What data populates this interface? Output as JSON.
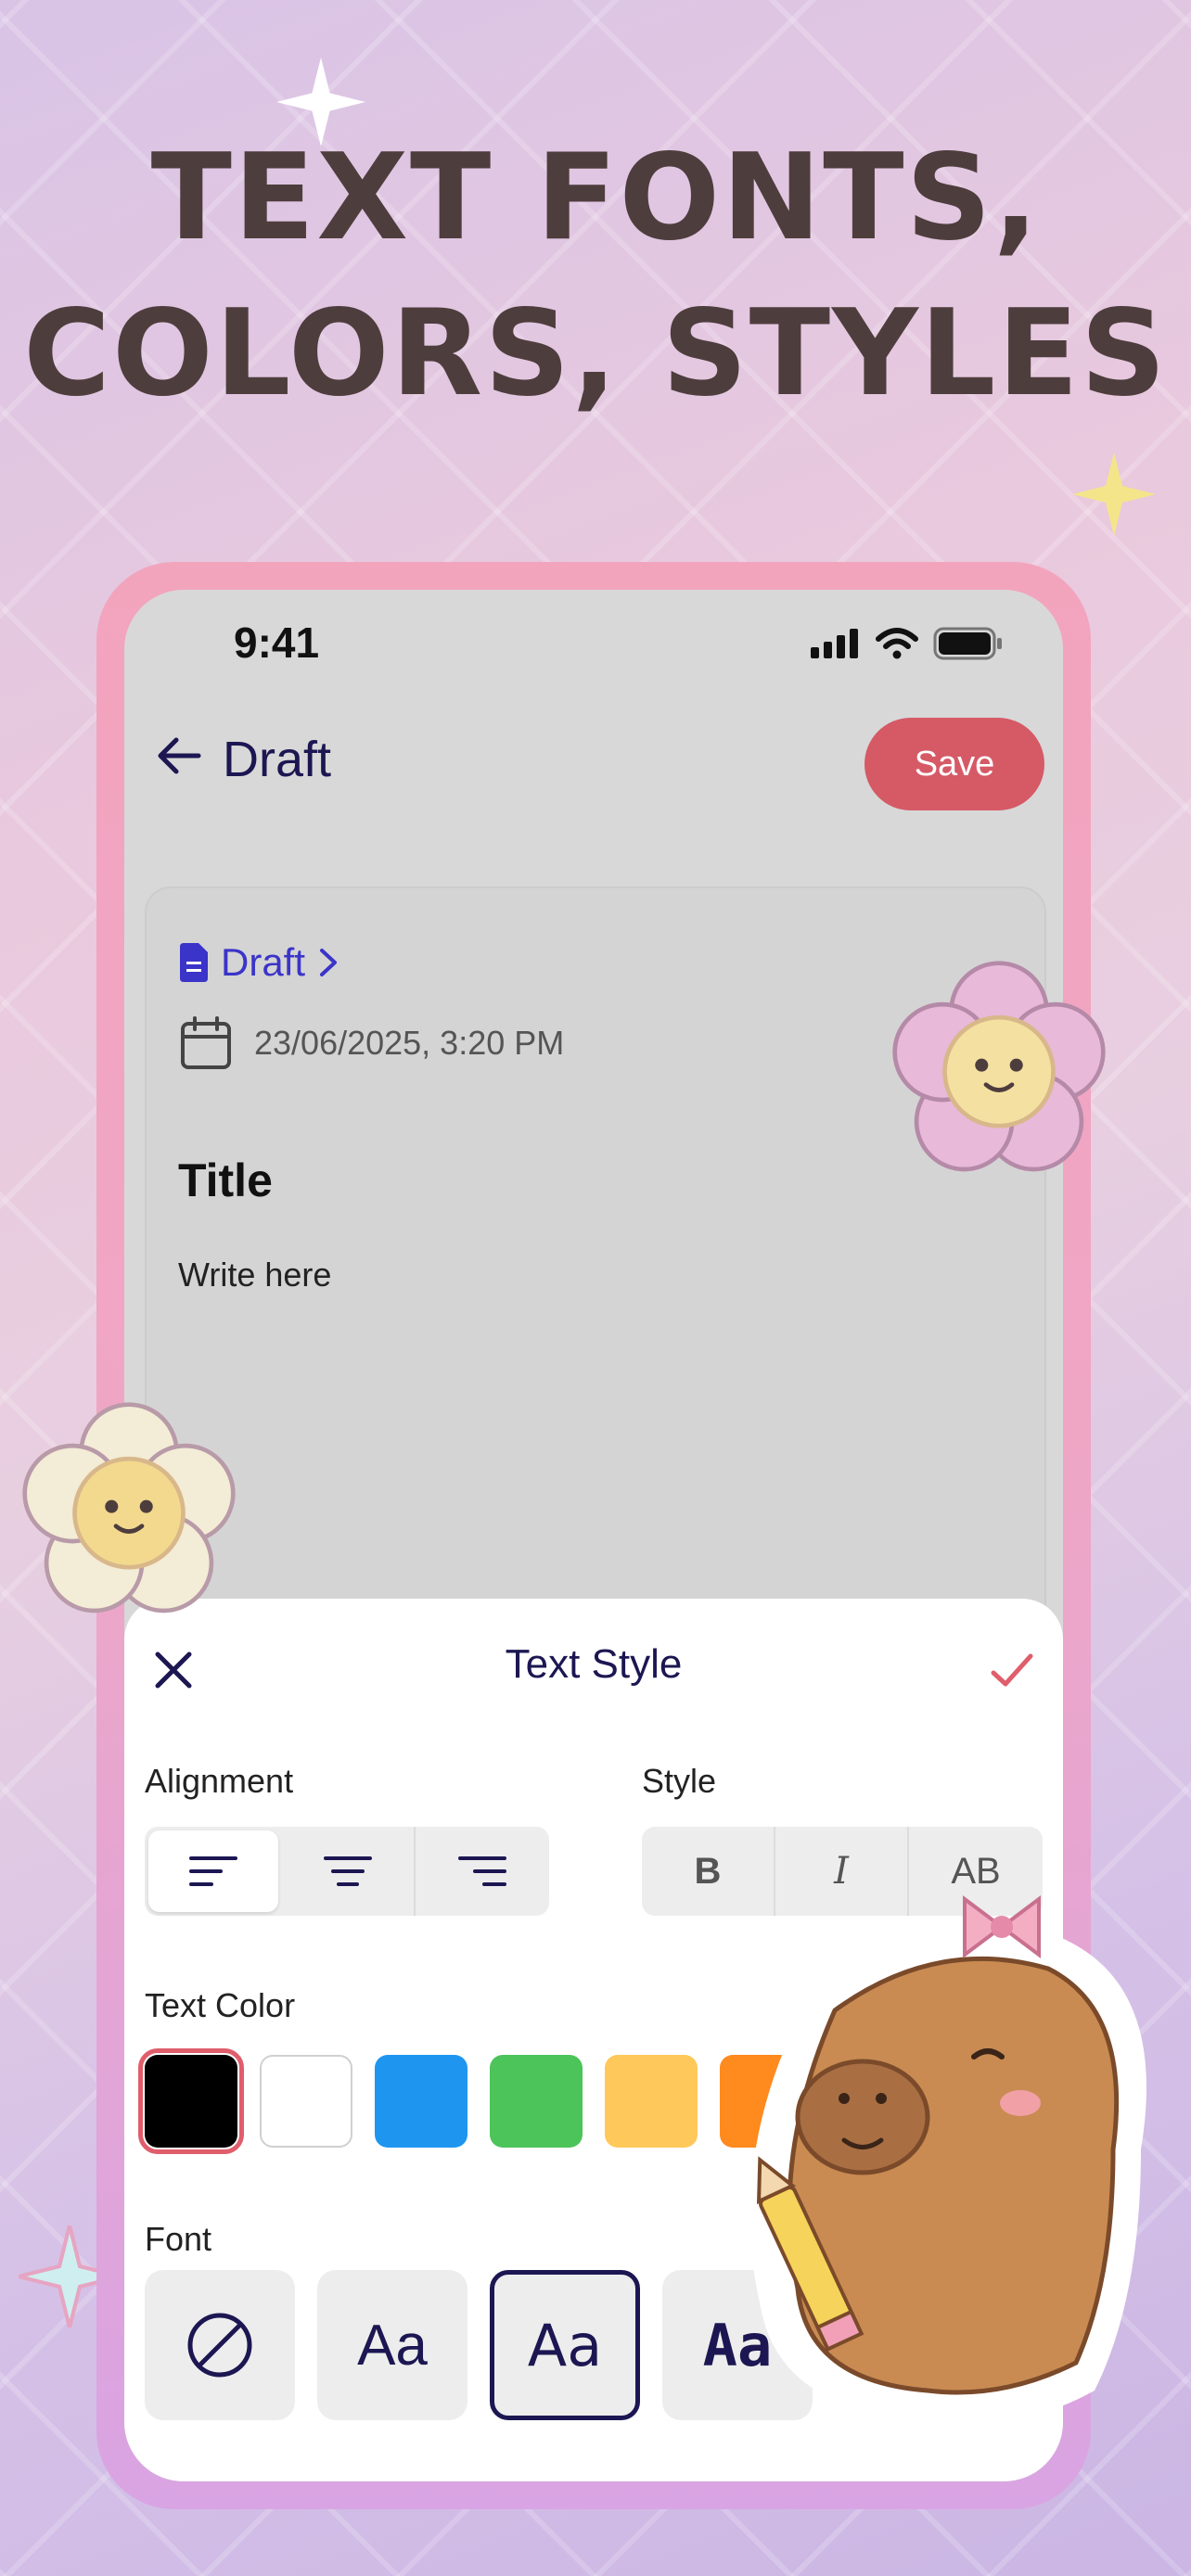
{
  "headline": {
    "line1": "TEXT FONTS,",
    "line2": "COLORS, STYLES"
  },
  "status": {
    "time": "9:41"
  },
  "appbar": {
    "title": "Draft",
    "save_label": "Save"
  },
  "note": {
    "breadcrumb": "Draft",
    "date": "23/06/2025, 3:20 PM",
    "title": "Title",
    "body": "Write here"
  },
  "sheet": {
    "title": "Text Style",
    "alignment_label": "Alignment",
    "style_label": "Style",
    "style_options": [
      "B",
      "I",
      "AB"
    ],
    "text_color_label": "Text Color",
    "colors": [
      "#000000",
      "#ffffff",
      "#1e96f0",
      "#4cc45a",
      "#ffc85a",
      "#ff8a1e"
    ],
    "selected_color": "#000000",
    "font_label": "Font",
    "font_samples": [
      "Aa",
      "Aa",
      "Aa"
    ]
  },
  "colors": {
    "accent": "#d55a66",
    "primary_text": "#1c1752",
    "link": "#3b34c8"
  }
}
